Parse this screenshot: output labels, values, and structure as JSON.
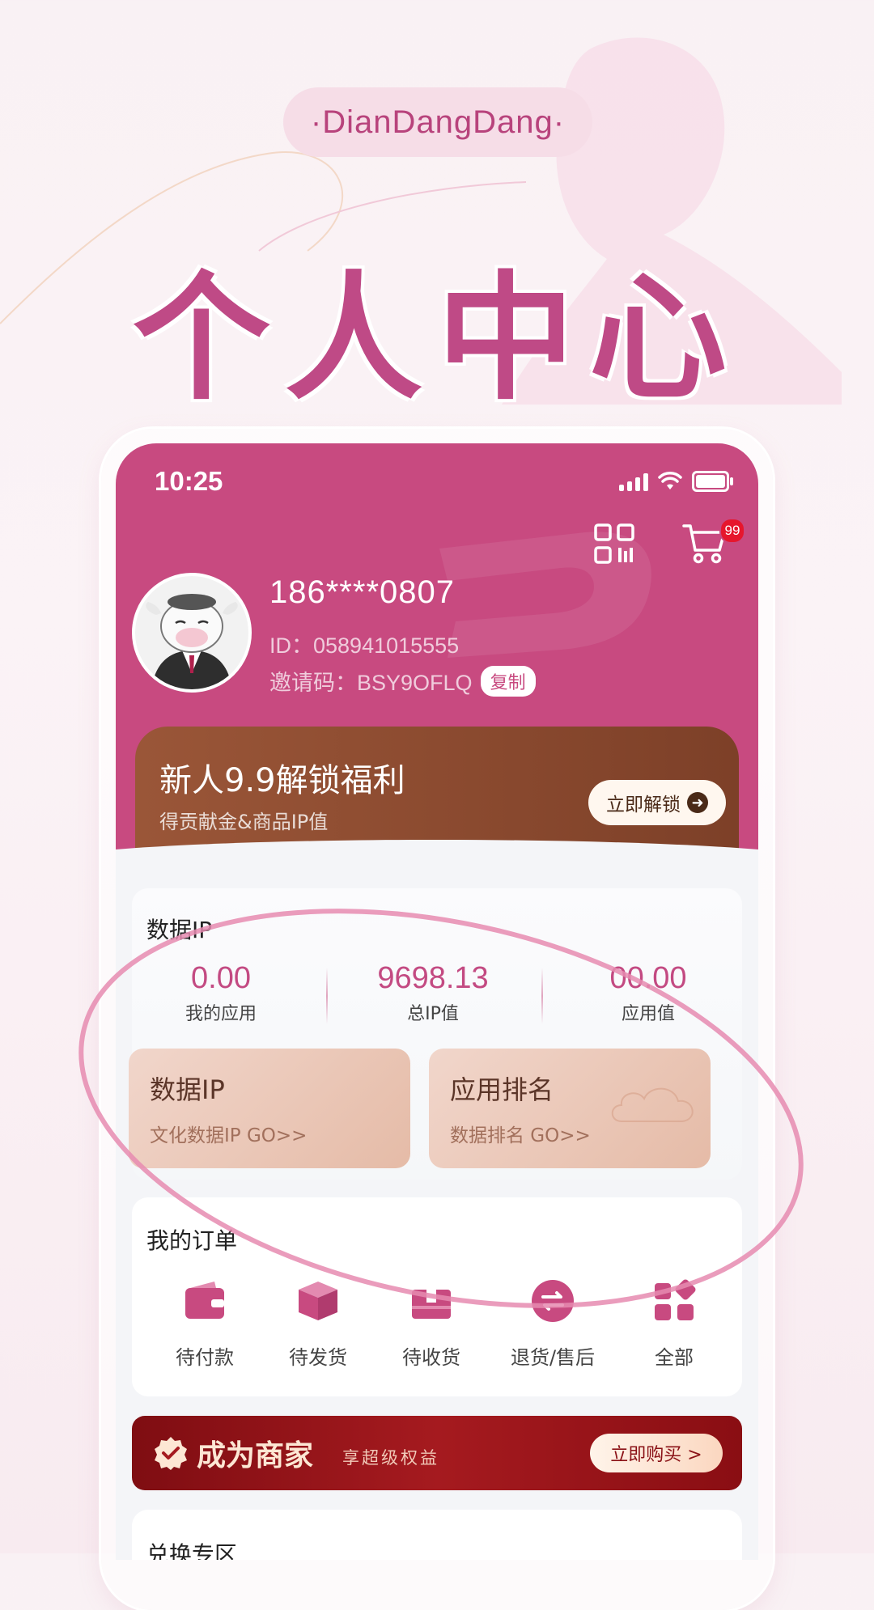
{
  "poster": {
    "brand": "·DianDangDang·",
    "title": "个人中心"
  },
  "status_bar": {
    "time": "10:25"
  },
  "profile": {
    "phone": "186****0807",
    "id_text": "ID：058941015555",
    "invite_text": "邀请码：BSY9OFLQ",
    "copy_label": "复制",
    "cart_badge": "99"
  },
  "promo": {
    "title": "新人9.9解锁福利",
    "subtitle": "得贡献金&商品IP值",
    "button": "立即解锁"
  },
  "data_ip": {
    "title": "数据IP",
    "stats": [
      {
        "value": "0.00",
        "label": "我的应用"
      },
      {
        "value": "9698.13",
        "label": "总IP值"
      },
      {
        "value": "00.00",
        "label": "应用值"
      }
    ],
    "tiles": [
      {
        "title": "数据IP",
        "sub": "文化数据IP GO>>"
      },
      {
        "title": "应用排名",
        "sub": "数据排名 GO>>"
      }
    ]
  },
  "orders": {
    "title": "我的订单",
    "items": [
      {
        "label": "待付款",
        "icon": "wallet-icon"
      },
      {
        "label": "待发货",
        "icon": "box-icon"
      },
      {
        "label": "待收货",
        "icon": "package-icon"
      },
      {
        "label": "退货/售后",
        "icon": "exchange-icon"
      },
      {
        "label": "全部",
        "icon": "grid-icon"
      }
    ]
  },
  "merchant": {
    "title": "成为商家",
    "subtitle": "享超级权益",
    "button": "立即购买 >"
  },
  "exchange": {
    "title": "兑换专区"
  },
  "colors": {
    "brand": "#c84a80",
    "promo_brown": "#8c4b30",
    "merchant_red": "#a51a1f"
  }
}
